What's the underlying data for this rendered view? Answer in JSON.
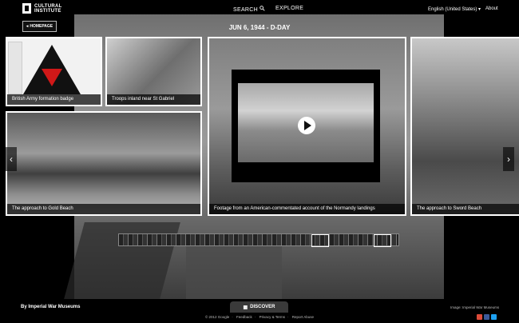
{
  "header": {
    "logo_line1": "CULTURAL",
    "logo_line2": "INSTITUTE",
    "search_label": "SEARCH",
    "explore_label": "EXPLORE",
    "language": "English (United States)",
    "about_label": "About"
  },
  "homepage_label": "HOMEPAGE",
  "title": "JUN 6, 1944 - D-DAY",
  "cards": [
    {
      "caption": "British Army formation badge"
    },
    {
      "caption": "Troops inland near St Gabriel"
    },
    {
      "caption": "The approach to Gold Beach"
    },
    {
      "caption": "Footage from an American-commentated account of the Normandy landings"
    },
    {
      "caption": "The approach to Sword Beach"
    }
  ],
  "footer": {
    "byline": "By Imperial War Museums",
    "discover_label": "DISCOVER",
    "copyright": "© 2012 Google",
    "feedback": "Feedback",
    "privacy": "Privacy & Terms",
    "report": "Report Abuse",
    "image_credit": "Image: Imperial War Museums"
  },
  "icons": {
    "search": "search-icon",
    "play": "play-icon",
    "prev": "chevron-left-icon",
    "next": "chevron-right-icon"
  },
  "colors": {
    "badge_red": "#d01818",
    "background": "#000000",
    "google_plus": "#dd4b39",
    "facebook": "#3b5998",
    "twitter": "#1da1f2"
  }
}
